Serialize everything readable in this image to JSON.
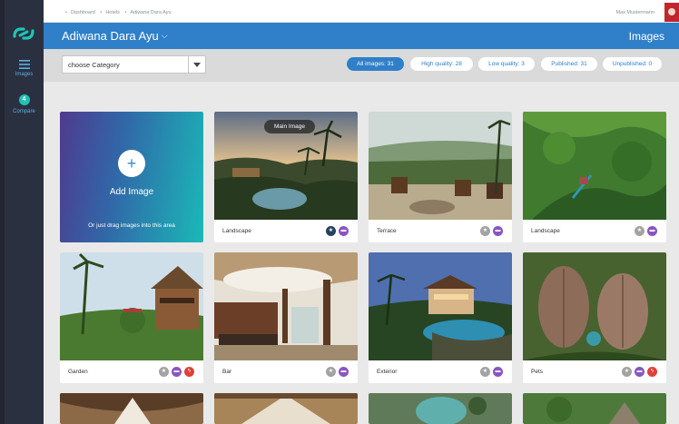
{
  "sidebar": {
    "items": [
      {
        "label": "Images",
        "icon": "menu-icon"
      },
      {
        "label": "Compare",
        "badge": "4",
        "icon": "compare-badge"
      }
    ]
  },
  "breadcrumb": [
    "Dashboard",
    "Hotels",
    "Adiwana Dara Ayu"
  ],
  "user": {
    "name": "Max Mustermann"
  },
  "header": {
    "hotel_name": "Adiwana Dara Ayu",
    "section": "Images"
  },
  "filters": {
    "category_select": "choose Category",
    "pills": [
      {
        "label": "All images: 31",
        "active": true
      },
      {
        "label": "High quality: 28",
        "active": false
      },
      {
        "label": "Low quality: 3",
        "active": false
      },
      {
        "label": "Published: 31",
        "active": false
      },
      {
        "label": "Unpublished: 0",
        "active": false
      }
    ]
  },
  "add_card": {
    "title": "Add Image",
    "subtitle": "Or just drag images into this area",
    "icon": "plus-icon"
  },
  "images": [
    {
      "caption": "Landscape",
      "badge": "Main Image",
      "icons": [
        "star-on-icon",
        "bed-icon"
      ]
    },
    {
      "caption": "Terrace",
      "icons": [
        "star-off-icon",
        "bed-icon"
      ]
    },
    {
      "caption": "Landscape",
      "icons": [
        "star-off-icon",
        "bed-icon"
      ]
    },
    {
      "caption": "Garden",
      "icons": [
        "star-off-icon",
        "bed-icon",
        "bolt-icon"
      ]
    },
    {
      "caption": "Bar",
      "icons": [
        "star-off-icon",
        "bed-icon"
      ]
    },
    {
      "caption": "Exterior",
      "icons": [
        "star-off-icon",
        "bed-icon"
      ]
    },
    {
      "caption": "Pets",
      "icons": [
        "star-off-icon",
        "bed-icon",
        "bolt-icon"
      ]
    }
  ],
  "colors": {
    "accent": "#2f7fc9",
    "sidebar": "#2b3040",
    "teal": "#20c0b8",
    "bed": "#8a55c2",
    "bolt": "#e0403a",
    "star_on": "#24415f",
    "star_off": "#a3a3a3"
  }
}
